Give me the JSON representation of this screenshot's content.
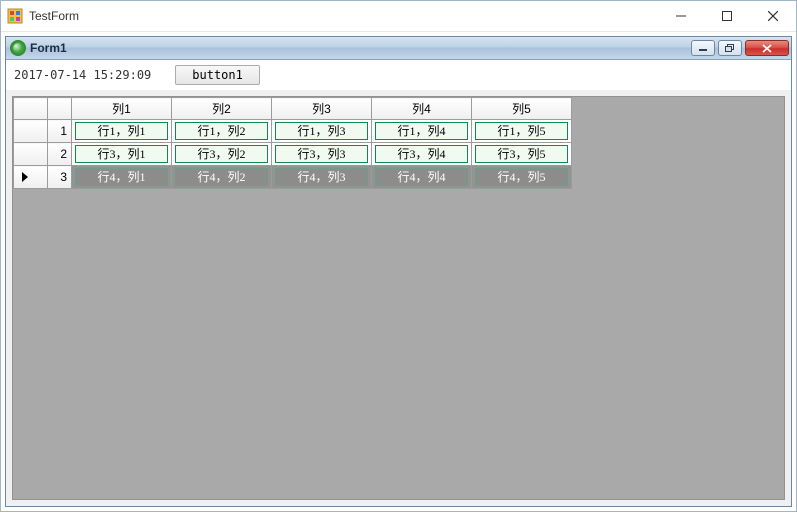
{
  "outer": {
    "title": "TestForm"
  },
  "child": {
    "title": "Form1"
  },
  "toolbar": {
    "timestamp": "2017-07-14 15:29:09",
    "button1_label": "button1"
  },
  "grid": {
    "columns": [
      "列1",
      "列2",
      "列3",
      "列4",
      "列5"
    ],
    "row_numbers": [
      "1",
      "2",
      "3"
    ],
    "selected_row_index": 2,
    "rows": [
      [
        "行1，列1",
        "行1，列2",
        "行1，列3",
        "行1，列4",
        "行1，列5"
      ],
      [
        "行3，列1",
        "行3，列2",
        "行3，列3",
        "行3，列4",
        "行3，列5"
      ],
      [
        "行4，列1",
        "行4，列2",
        "行4，列3",
        "行4，列4",
        "行4，列5"
      ]
    ]
  }
}
